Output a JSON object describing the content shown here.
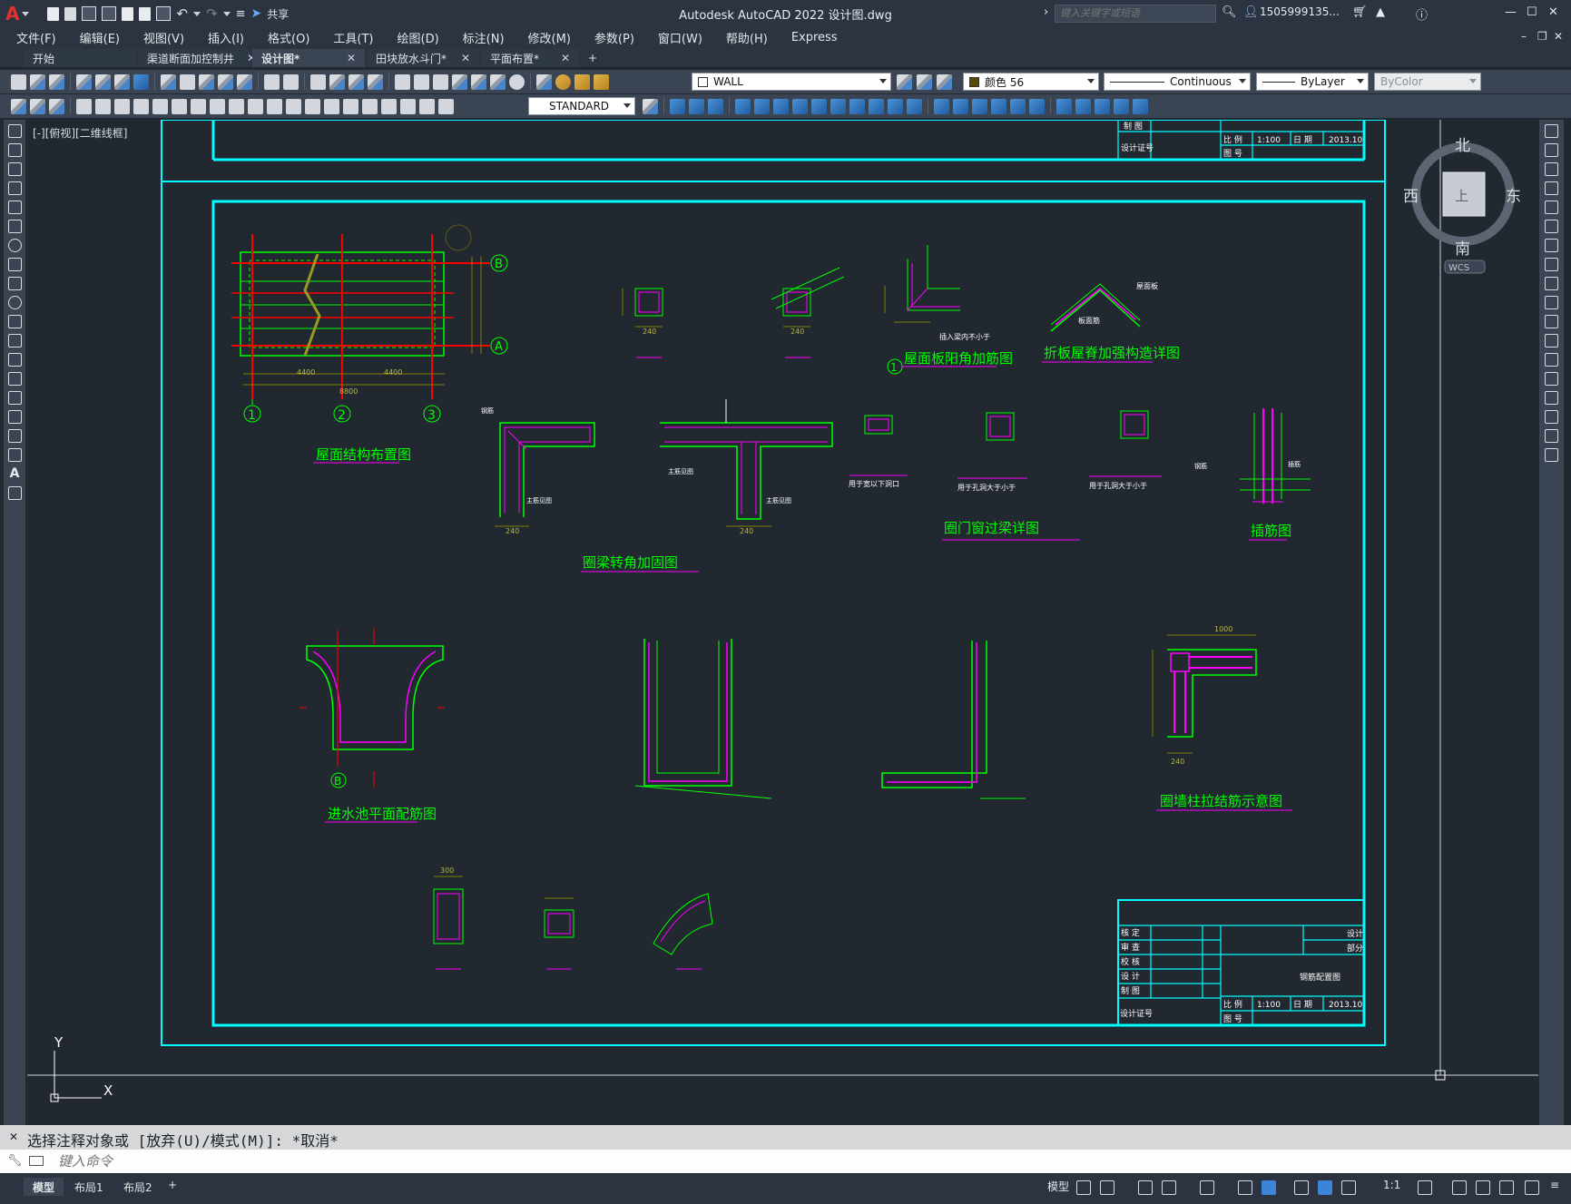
{
  "app": {
    "title": "Autodesk AutoCAD 2022    设计图.dwg",
    "search_placeholder": "键入关键字或短语",
    "user": "1505999135...",
    "share": "共享"
  },
  "menu": [
    "文件(F)",
    "编辑(E)",
    "视图(V)",
    "插入(I)",
    "格式(O)",
    "工具(T)",
    "绘图(D)",
    "标注(N)",
    "修改(M)",
    "参数(P)",
    "窗口(W)",
    "帮助(H)",
    "Express"
  ],
  "tabs": [
    {
      "label": "开始",
      "closable": false
    },
    {
      "label": "渠道断面加控制井",
      "closable": true
    },
    {
      "label": "设计图*",
      "closable": true
    },
    {
      "label": "田块放水斗门*",
      "closable": true
    },
    {
      "label": "平面布置*",
      "closable": true
    }
  ],
  "toolbar": {
    "layer": "WALL",
    "color": "颜色 56",
    "linetype": "Continuous",
    "lineweight": "ByLayer",
    "plotstyle": "ByColor",
    "textstyle": "STANDARD"
  },
  "viewport": {
    "label": "[-][俯视][二维线框]",
    "viewcube": {
      "north": "北",
      "south": "南",
      "east": "东",
      "west": "西",
      "top": "上",
      "wcs": "WCS"
    },
    "ucs_x": "X",
    "ucs_y": "Y"
  },
  "drawing": {
    "titles": {
      "roof_layout": "屋面结构布置图",
      "roof_corner": "屋面板阳角加筋图",
      "folded_roof": "折板屋脊加强构造详图",
      "ring_beam": "圈梁转角加固图",
      "lintel": "圈门窗过梁详图",
      "rebar": "插筋图",
      "inlet": "进水池平面配筋图",
      "wall_column": "圈墙柱拉结筋示意图"
    },
    "axes": [
      "1",
      "2",
      "3",
      "A",
      "B"
    ],
    "small_labels": {
      "inset": "插入梁内不小于",
      "ridge": "屋面板",
      "ridge2": "板面筋",
      "hole1": "用于孔洞大于小于",
      "hole2": "用于孔洞大于小于",
      "hole3": "用于宽以下洞口",
      "beam1": "主筋见图",
      "beam2": "主筋见图",
      "beam3": "主筋见图",
      "beam4": "主筋见图",
      "rebar1": "钢筋",
      "rebar2": "插筋"
    },
    "dims": {
      "d240": "240",
      "d4400": "4400",
      "d8800": "8800",
      "d300": "300",
      "d1000": "1000"
    },
    "title_block": {
      "scale_label": "比 例",
      "scale": "1:100",
      "date_label": "日 期",
      "date": "2013.10",
      "drawno_label": "图 号",
      "drawing_name": "钢筋配置图",
      "rows": [
        "核 定",
        "审 查",
        "校 核",
        "设 计",
        "制 图"
      ],
      "cert": "设计证号",
      "design": "设计",
      "part": "部分",
      "top_row": "制 图"
    }
  },
  "command": {
    "history": "选择注释对象或 [放弃(U)/模式(M)]: *取消*",
    "placeholder": "键入命令"
  },
  "status": {
    "layouts": [
      "模型",
      "布局1",
      "布局2"
    ],
    "model": "模型",
    "scale": "1:1"
  },
  "colors": {
    "cyan": "#00ffff",
    "green": "#00ff00",
    "magenta": "#ff00ff",
    "red": "#ff0000",
    "olive": "#7f7f00"
  }
}
